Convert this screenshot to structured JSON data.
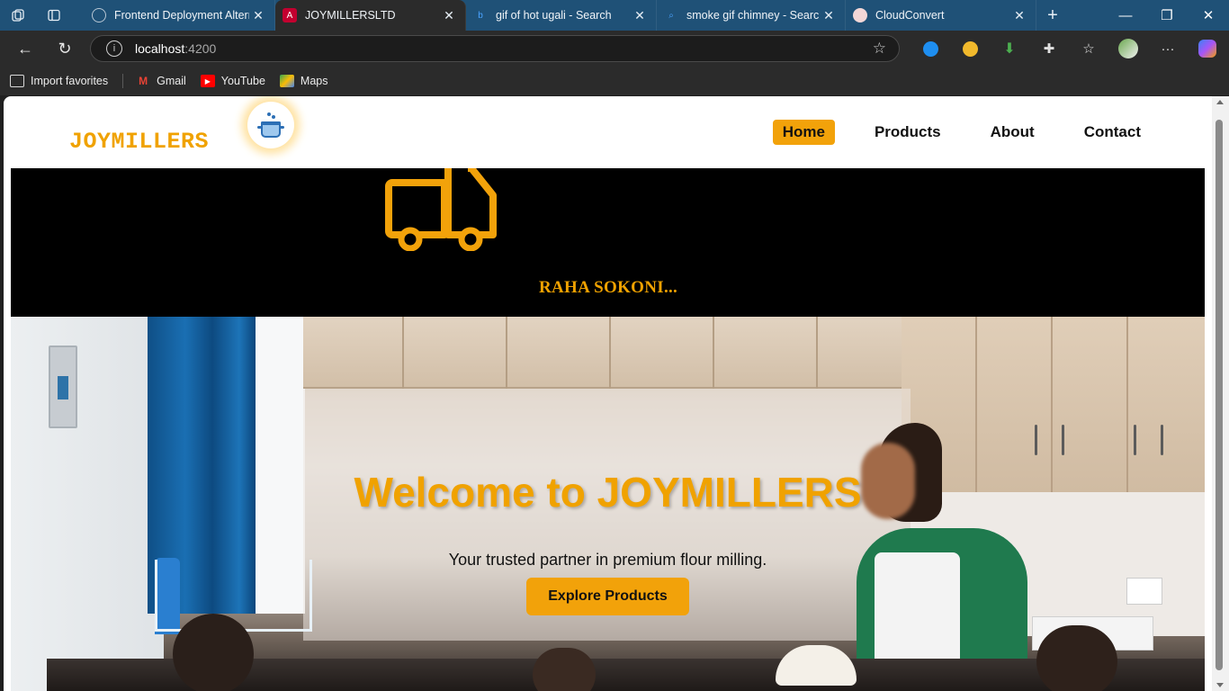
{
  "browser": {
    "tabs": [
      {
        "title": "Frontend Deployment Altern",
        "favicon": "gear-icon",
        "active": false
      },
      {
        "title": "JOYMILLERSLTD",
        "favicon": "angular-icon",
        "active": true
      },
      {
        "title": "gif of hot ugali - Search",
        "favicon": "bing-search-icon",
        "active": false
      },
      {
        "title": "smoke gif chimney - Search",
        "favicon": "bing-search-icon",
        "active": false
      },
      {
        "title": "CloudConvert",
        "favicon": "cloudconvert-icon",
        "active": false
      }
    ],
    "address": {
      "host": "localhost",
      "port": ":4200"
    },
    "bookmarks": [
      {
        "label": "Import favorites",
        "icon": "import-icon"
      },
      {
        "label": "Gmail",
        "icon": "gmail-icon"
      },
      {
        "label": "YouTube",
        "icon": "youtube-icon"
      },
      {
        "label": "Maps",
        "icon": "maps-icon"
      }
    ],
    "colors": {
      "tabbar": "#1f5177",
      "chrome": "#2b2b2b"
    }
  },
  "site": {
    "logo_text": "JOYMILLERS",
    "nav": [
      {
        "label": "Home",
        "active": true
      },
      {
        "label": "Products",
        "active": false
      },
      {
        "label": "About",
        "active": false
      },
      {
        "label": "Contact",
        "active": false
      }
    ],
    "banner": {
      "tagline": "RAHA SOKONI..."
    },
    "hero": {
      "title": "Welcome to JOYMILLERS",
      "subtitle": "Your trusted partner in premium flour milling.",
      "cta": "Explore Products"
    },
    "colors": {
      "accent": "#f2a20a",
      "brand_text": "#f0a200",
      "banner_bg": "#000000"
    }
  }
}
